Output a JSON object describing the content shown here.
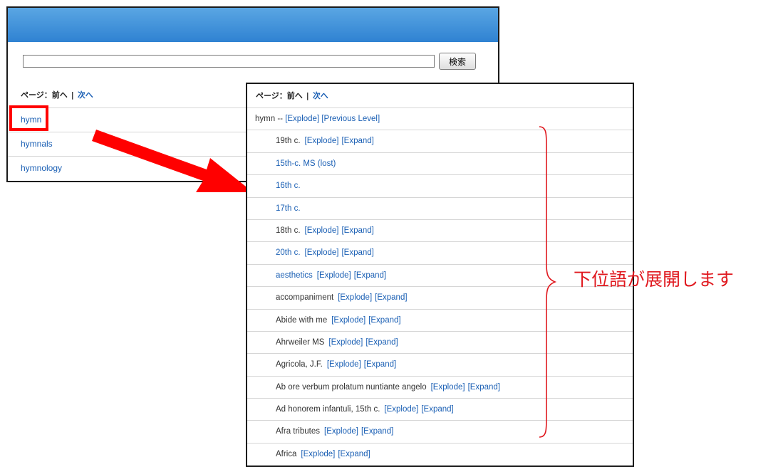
{
  "search": {
    "value": "",
    "button_label": "検索"
  },
  "back_pager": {
    "label": "ページ：前へ",
    "separator": "|",
    "next": "次へ"
  },
  "back_list": [
    {
      "label": "hymn"
    },
    {
      "label": "hymnals"
    },
    {
      "label": "hymnology"
    }
  ],
  "front_pager": {
    "label": "ページ：前へ",
    "separator": "|",
    "next": "次へ"
  },
  "front_top": {
    "label": "hymn --",
    "explode": "[Explode]",
    "previous_level": "[Previous Level]"
  },
  "front_children": [
    {
      "label": "19th c.",
      "is_link": false,
      "explode": "[Explode]",
      "expand": "[Expand]"
    },
    {
      "label": "15th-c. MS (lost)",
      "is_link": true
    },
    {
      "label": "16th c.",
      "is_link": true
    },
    {
      "label": "17th c.",
      "is_link": true
    },
    {
      "label": "18th c.",
      "is_link": false,
      "explode": "[Explode]",
      "expand": "[Expand]"
    },
    {
      "label": "20th c.",
      "is_link": true,
      "explode": "[Explode]",
      "expand": "[Expand]"
    },
    {
      "label": "aesthetics",
      "is_link": true,
      "explode": "[Explode]",
      "expand": "[Expand]"
    },
    {
      "label": "accompaniment",
      "is_link": false,
      "explode": "[Explode]",
      "expand": "[Expand]"
    },
    {
      "label": "Abide with me",
      "is_link": false,
      "explode": "[Explode]",
      "expand": "[Expand]"
    },
    {
      "label": "Ahrweiler MS",
      "is_link": false,
      "explode": "[Explode]",
      "expand": "[Expand]"
    },
    {
      "label": "Agricola, J.F.",
      "is_link": false,
      "explode": "[Explode]",
      "expand": "[Expand]"
    },
    {
      "label": "Ab ore verbum prolatum nuntiante angelo",
      "is_link": false,
      "explode": "[Explode]",
      "expand": "[Expand]"
    },
    {
      "label": "Ad honorem infantuli, 15th c.",
      "is_link": false,
      "explode": "[Explode]",
      "expand": "[Expand]"
    },
    {
      "label": "Afra tributes",
      "is_link": false,
      "explode": "[Explode]",
      "expand": "[Expand]"
    },
    {
      "label": "Africa",
      "is_link": false,
      "explode": "[Explode]",
      "expand": "[Expand]"
    }
  ],
  "annotation": {
    "caption": "下位語が展開します",
    "highlight_color": "#ff0000",
    "arrow_color": "#ff0000",
    "brace_color": "#e0191f"
  },
  "colors": {
    "link": "#1a5fb4",
    "header_gradient_top": "#5aa6e3",
    "header_gradient_bottom": "#2f82d2"
  }
}
